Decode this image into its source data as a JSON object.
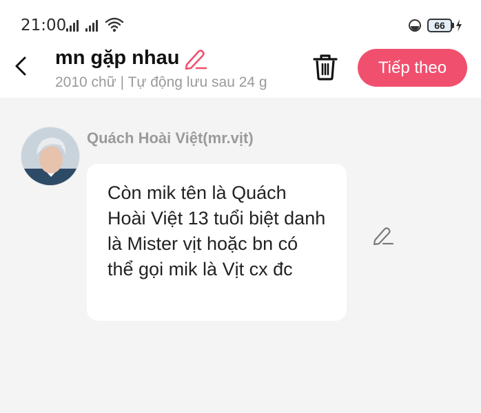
{
  "status_bar": {
    "time": "21:00",
    "battery_level": "66",
    "icons": [
      "signal-icon",
      "signal-icon",
      "wifi-icon",
      "do-not-disturb-icon",
      "battery-icon",
      "charging-icon"
    ]
  },
  "header": {
    "title": "mn gặp nhau",
    "meta": "2010 chữ | Tự động lưu sau 24 g",
    "next_label": "Tiếp theo",
    "icons": [
      "back-icon",
      "edit-icon",
      "trash-icon"
    ]
  },
  "message": {
    "author": "Quách Hoài Việt(mr.vịt)",
    "text": "Còn mik tên là Quách Hoài Việt 13 tuổi biệt danh là Mister vịt hoặc bn có thể gọi mik là Vịt cx đc"
  },
  "colors": {
    "accent": "#f0506e",
    "background": "#f4f4f4",
    "muted_text": "#9a9a9a"
  }
}
